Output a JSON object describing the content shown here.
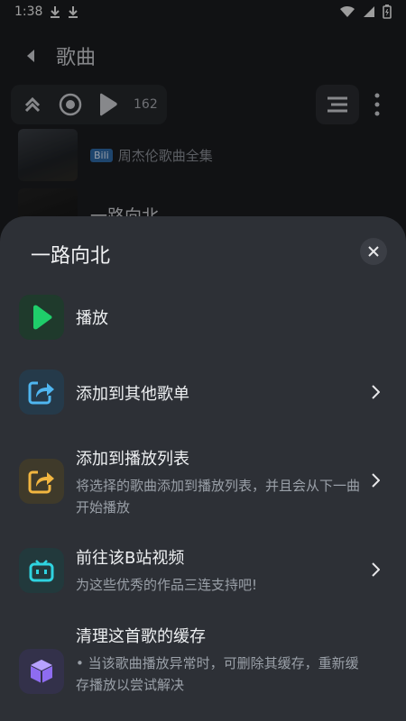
{
  "status": {
    "time": "1:38"
  },
  "background": {
    "title": "歌曲",
    "count": "162",
    "song1_sub_badge": "Bili",
    "song1_sub": "周杰伦歌曲全集",
    "song2_title": "一路向北"
  },
  "sheet": {
    "title": "一路向北",
    "items": [
      {
        "title": "播放"
      },
      {
        "title": "添加到其他歌单"
      },
      {
        "title": "添加到播放列表",
        "desc": "将选择的歌曲添加到播放列表，并且会从下一曲开始播放"
      },
      {
        "title": "前往该B站视频",
        "desc": "为这些优秀的作品三连支持吧!"
      },
      {
        "title": "清理这首歌的缓存",
        "desc": "• 当该歌曲播放异常时，可删除其缓存，重新缓存播放以尝试解决"
      }
    ]
  },
  "colors": {
    "sheet_bg": "#2d3036",
    "play_green": "#1fce6a",
    "share_blue": "#4fb6f0",
    "share_yellow": "#f2b640",
    "bili_cyan": "#2fd3e0",
    "cube_purple": "#8e6cf0"
  }
}
